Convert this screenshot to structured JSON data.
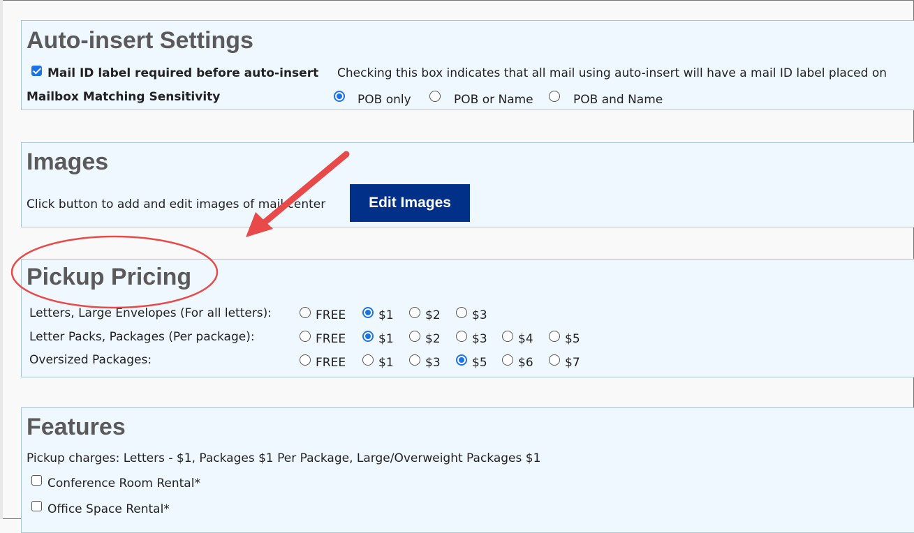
{
  "auto_insert": {
    "title": "Auto-insert Settings",
    "mail_id_label": "Mail ID label required before auto-insert",
    "mail_id_desc": "Checking this box indicates that all mail using auto-insert will have a mail ID label placed on",
    "sensitivity_label": "Mailbox Matching Sensitivity",
    "options": [
      "POB only",
      "POB or Name",
      "POB and Name"
    ],
    "selected": "POB only"
  },
  "images": {
    "title": "Images",
    "desc": "Click button to add and edit images of mail center",
    "button_label": "Edit Images"
  },
  "pickup_pricing": {
    "title": "Pickup Pricing",
    "rows": [
      {
        "label": "Letters, Large Envelopes (For all letters):",
        "options": [
          "FREE",
          "$1",
          "$2",
          "$3"
        ],
        "selected": "$1"
      },
      {
        "label": "Letter Packs, Packages (Per package):",
        "options": [
          "FREE",
          "$1",
          "$2",
          "$3",
          "$4",
          "$5"
        ],
        "selected": "$1"
      },
      {
        "label": "Oversized Packages:",
        "options": [
          "FREE",
          "$1",
          "$3",
          "$5",
          "$6",
          "$7"
        ],
        "selected": "$5"
      }
    ]
  },
  "features": {
    "title": "Features",
    "pickup_charges": "Pickup charges: Letters - $1, Packages $1 Per Package, Large/Overweight Packages $1",
    "items": [
      "Conference Room Rental*",
      "Office Space Rental*"
    ]
  },
  "colors": {
    "panel_bg": "#f0f8ff",
    "button_bg": "#003087",
    "accent": "#1a73e8",
    "annotation": "#e84a4a"
  }
}
